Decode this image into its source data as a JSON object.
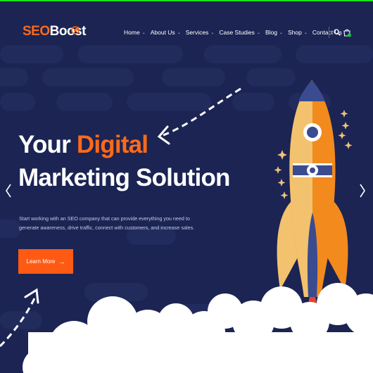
{
  "brand": {
    "name_part1": "SEO",
    "name_part2": "Boost"
  },
  "nav": {
    "items": [
      {
        "label": "Home",
        "caret": "⌄"
      },
      {
        "label": "About Us",
        "caret": "⌄"
      },
      {
        "label": "Services",
        "caret": "⌄"
      },
      {
        "label": "Case Studies",
        "caret": "⌄"
      },
      {
        "label": "Blog",
        "caret": "⌄"
      },
      {
        "label": "Shop",
        "caret": "⌄"
      },
      {
        "label": "Contact Us",
        "caret": ""
      }
    ]
  },
  "hero": {
    "title_word1": "Your",
    "title_word2": "Digital",
    "title_line2": "Marketing Solution",
    "description": "Start working with an SEO company that can provide everything you need to generate awareness, drive traffic, connect with customers, and increase sales.",
    "button_label": "Learn More",
    "button_arrow": "→"
  },
  "colors": {
    "background": "#1b2453",
    "accent": "#ff6a1a",
    "button": "#ff5a14",
    "status_bar": "#18e318"
  },
  "icons": [
    "logo-target-icon",
    "search-icon",
    "cart-icon",
    "chevron-left-icon",
    "chevron-right-icon",
    "rocket-illustration",
    "cloud-illustration",
    "dashed-arrow-icon"
  ]
}
